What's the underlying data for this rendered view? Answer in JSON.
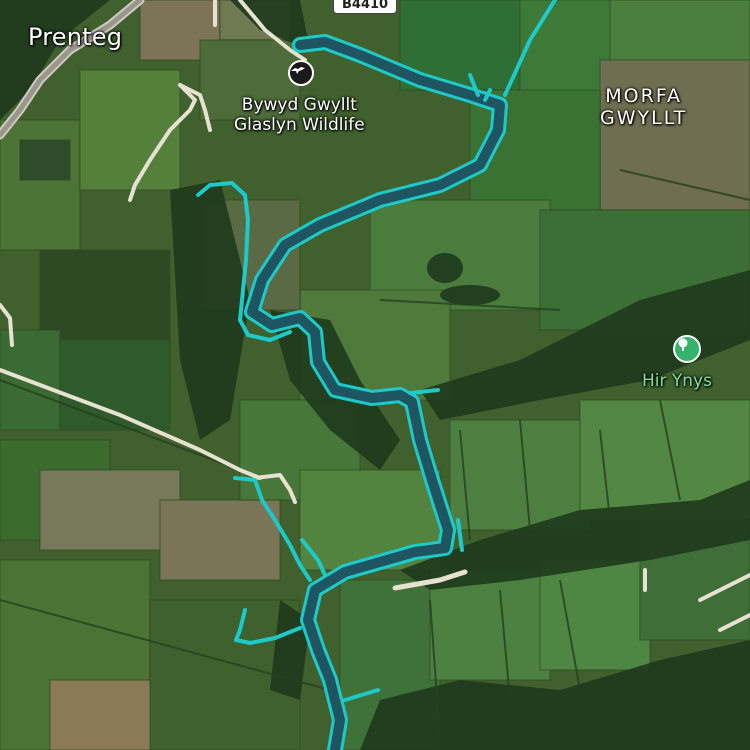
{
  "map": {
    "road_shield": "B4410",
    "places": {
      "prenteg": "Prenteg",
      "morfa_line1": "MORFA",
      "morfa_line2": "GWYLLT"
    },
    "pois": {
      "wildlife_line1": "Bywyd Gwyllt",
      "wildlife_line2": "Glaslyn Wildlife",
      "wildlife_icon": "osprey-bird-icon",
      "park_name": "Hir Ynys",
      "park_icon": "tree-icon"
    },
    "colors": {
      "river": "#1ec9c9",
      "river_fill": "#1e5560",
      "road": "#e6e1d0",
      "park_pin": "#33b36b"
    }
  }
}
